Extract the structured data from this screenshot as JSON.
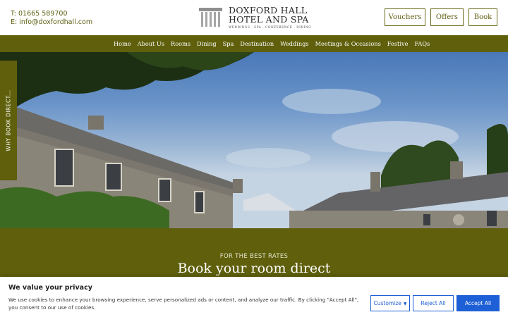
{
  "header": {
    "phone": "T: 01665 589700",
    "email": "E: info@doxfordhall.com",
    "logo": {
      "line1": "DOXFORD HALL",
      "line2": "HOTEL AND SPA",
      "tagline": "WEDDINGS · SPA · CONFERENCE · DINING"
    },
    "buttons": {
      "vouchers": "Vouchers",
      "offers": "Offers",
      "book": "Book"
    }
  },
  "nav": {
    "items": [
      "Home",
      "About Us",
      "Rooms",
      "Dining",
      "Spa",
      "Destination",
      "Weddings",
      "Meetings & Occasions",
      "Festive",
      "FAQs"
    ]
  },
  "side_tab": {
    "label": "WHY BOOK DIRECT..."
  },
  "booking": {
    "kicker": "FOR THE BEST RATES",
    "title": "Book your room direct"
  },
  "cookie": {
    "title": "We value your privacy",
    "text": "We use cookies to enhance your browsing experience, serve personalized ads or content, and analyze our traffic. By clicking \"Accept All\", you consent to our use of cookies.",
    "customize": "Customize",
    "reject": "Reject All",
    "accept": "Accept All"
  },
  "colors": {
    "brand_olive": "#5f5f0c",
    "cookie_blue": "#1d5fd6"
  }
}
